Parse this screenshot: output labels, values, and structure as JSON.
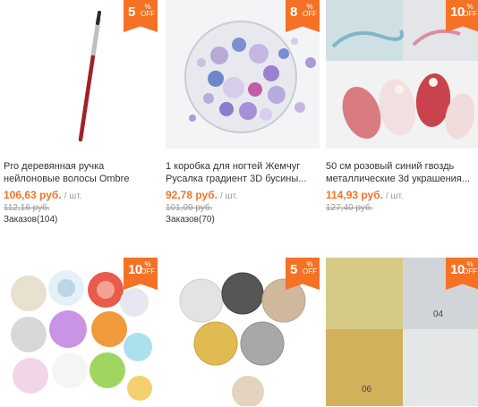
{
  "colors": {
    "accent": "#f57224",
    "text": "#333333",
    "muted": "#999999"
  },
  "products": [
    {
      "discount": "5",
      "off": "OFF",
      "pct": "%",
      "title": "Pro деревянная ручка нейлоновые волосы Ombre Кисть Nail...",
      "price": "106,63 руб.",
      "unit": "/ шт.",
      "old_price": "112,16 руб.",
      "orders": "Заказов(104)"
    },
    {
      "discount": "8",
      "off": "OFF",
      "pct": "%",
      "title": "1 коробка для ногтей Жемчуг Русалка градиент 3D бусины...",
      "price": "92,78 руб.",
      "unit": "/ шт.",
      "old_price": "101,09 руб.",
      "orders": "Заказов(70)"
    },
    {
      "discount": "10",
      "off": "OFF",
      "pct": "%",
      "title": "50 см розовый синий гвоздь металлические 3d украшения...",
      "price": "114,93 руб.",
      "unit": "/ шт.",
      "old_price": "127,40 руб.",
      "orders": ""
    },
    {
      "discount": "10",
      "off": "OFF",
      "pct": "%"
    },
    {
      "discount": "5",
      "off": "OFF",
      "pct": "%"
    },
    {
      "discount": "10",
      "off": "OFF",
      "pct": "%"
    }
  ],
  "photo_labels": {
    "p6a": "04",
    "p6b": "06"
  }
}
